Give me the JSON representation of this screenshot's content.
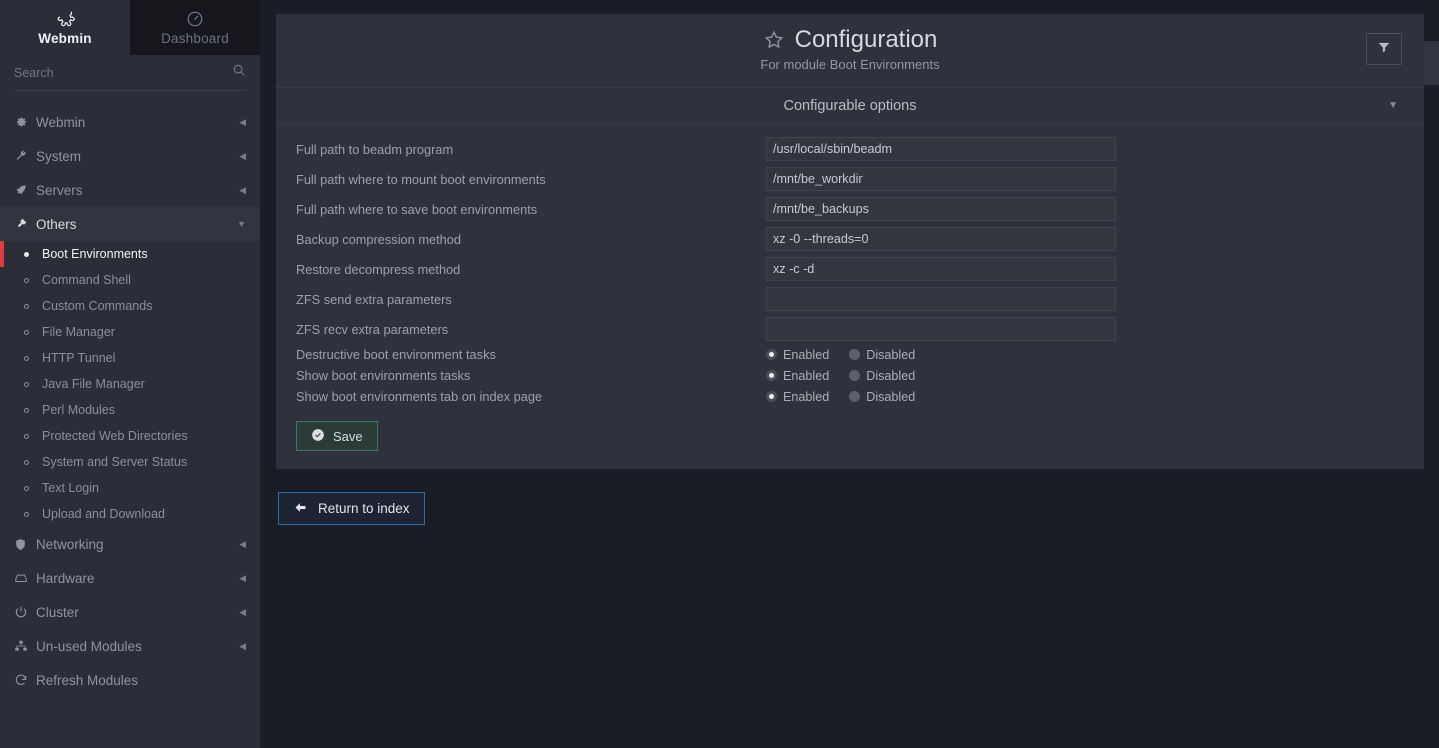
{
  "brand": {
    "tabs": [
      {
        "label": "Webmin",
        "icon": "webmin-logo-icon",
        "active": true
      },
      {
        "label": "Dashboard",
        "icon": "gauge-icon",
        "active": false
      }
    ]
  },
  "search": {
    "placeholder": "Search",
    "value": "",
    "icon": "search-icon"
  },
  "sidebar": {
    "groups": [
      {
        "label": "Webmin",
        "icon": "gear-icon",
        "state": "collapsed"
      },
      {
        "label": "System",
        "icon": "wrench-icon",
        "state": "collapsed"
      },
      {
        "label": "Servers",
        "icon": "rocket-icon",
        "state": "collapsed"
      },
      {
        "label": "Others",
        "icon": "hammer-icon",
        "state": "expanded"
      }
    ],
    "others_items": [
      {
        "label": "Boot Environments",
        "active": true
      },
      {
        "label": "Command Shell",
        "active": false
      },
      {
        "label": "Custom Commands",
        "active": false
      },
      {
        "label": "File Manager",
        "active": false
      },
      {
        "label": "HTTP Tunnel",
        "active": false
      },
      {
        "label": "Java File Manager",
        "active": false
      },
      {
        "label": "Perl Modules",
        "active": false
      },
      {
        "label": "Protected Web Directories",
        "active": false
      },
      {
        "label": "System and Server Status",
        "active": false
      },
      {
        "label": "Text Login",
        "active": false
      },
      {
        "label": "Upload and Download",
        "active": false
      }
    ],
    "bottom_groups": [
      {
        "label": "Networking",
        "icon": "shield-icon",
        "state": "collapsed"
      },
      {
        "label": "Hardware",
        "icon": "harddrive-icon",
        "state": "collapsed"
      },
      {
        "label": "Cluster",
        "icon": "power-icon",
        "state": "collapsed"
      },
      {
        "label": "Un-used Modules",
        "icon": "sitemap-icon",
        "state": "collapsed"
      },
      {
        "label": "Refresh Modules",
        "icon": "refresh-icon",
        "state": "none"
      }
    ]
  },
  "header": {
    "title": "Configuration",
    "subtitle": "For module Boot Environments",
    "star_icon": "star-outline-icon",
    "filter_icon": "filter-icon",
    "bell_icon": "bell-icon"
  },
  "section": {
    "title": "Configurable options",
    "caret_icon": "chevron-down-icon"
  },
  "fields": [
    {
      "label": "Full path to beadm program",
      "value": "/usr/local/sbin/beadm"
    },
    {
      "label": "Full path where to mount boot environments",
      "value": "/mnt/be_workdir"
    },
    {
      "label": "Full path where to save boot environments",
      "value": "/mnt/be_backups"
    },
    {
      "label": "Backup compression method",
      "value": "xz -0 --threads=0"
    },
    {
      "label": "Restore decompress method",
      "value": "xz -c -d"
    },
    {
      "label": "ZFS send extra parameters",
      "value": ""
    },
    {
      "label": "ZFS recv extra parameters",
      "value": ""
    }
  ],
  "radio_fields": [
    {
      "label": "Destructive boot environment tasks",
      "options": [
        {
          "label": "Enabled",
          "selected": true
        },
        {
          "label": "Disabled",
          "selected": false
        }
      ]
    },
    {
      "label": "Show boot environments tasks",
      "options": [
        {
          "label": "Enabled",
          "selected": true
        },
        {
          "label": "Disabled",
          "selected": false
        }
      ]
    },
    {
      "label": "Show boot environments tab on index page",
      "options": [
        {
          "label": "Enabled",
          "selected": true
        },
        {
          "label": "Disabled",
          "selected": false
        }
      ]
    }
  ],
  "buttons": {
    "save": {
      "label": "Save",
      "icon": "check-circle-icon"
    },
    "return": {
      "label": "Return to index",
      "icon": "arrow-left-icon"
    }
  },
  "colors": {
    "page_bg": "#1b1d26",
    "sidebar_bg": "#2b2e38",
    "panel_bg": "#2f323c",
    "active_marker": "#e03c3c",
    "save_border": "#2e7f60",
    "return_border": "#2e6ca8"
  }
}
